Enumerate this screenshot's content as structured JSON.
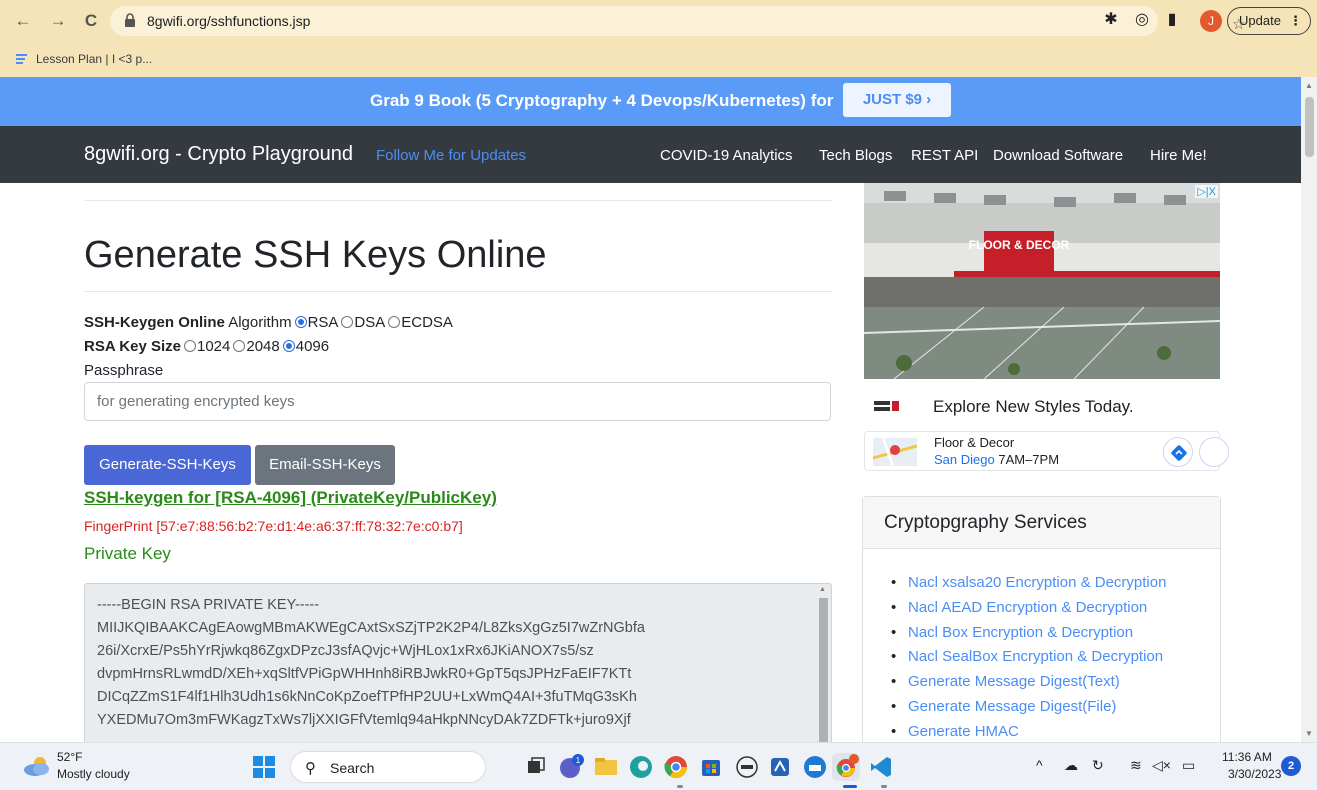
{
  "browser": {
    "url": "8gwifi.org/sshfunctions.jsp",
    "update_label": "Update",
    "profile_initial": "J",
    "bookmark": "Lesson Plan | I <3 p..."
  },
  "promo": {
    "text": "Grab 9 Book (5 Cryptography + 4 Devops/Kubernetes) for",
    "button": "JUST $9 ›"
  },
  "navbar": {
    "brand": "8gwifi.org - Crypto Playground",
    "follow": "Follow Me for Updates",
    "links": [
      "COVID-19 Analytics",
      "Tech Blogs",
      "REST API",
      "Download Software",
      "Hire Me!"
    ]
  },
  "main": {
    "title": "Generate SSH Keys Online",
    "algo_label": "SSH-Keygen Online",
    "algo_word": "Algorithm",
    "algorithms": [
      "RSA",
      "DSA",
      "ECDSA"
    ],
    "selected_algorithm": "RSA",
    "keysize_label": "RSA Key Size",
    "key_sizes": [
      "1024",
      "2048",
      "4096"
    ],
    "selected_key_size": "4096",
    "passphrase_label": "Passphrase",
    "passphrase_placeholder": "for generating encrypted keys",
    "generate_button": "Generate-SSH-Keys",
    "email_button": "Email-SSH-Keys",
    "result_link": "SSH-keygen for [RSA-4096] (PrivateKey/PublicKey)",
    "fingerprint": "FingerPrint [57:e7:88:56:b2:7e:d1:4e:a6:37:ff:78:32:7e:c0:b7]",
    "private_key_label": "Private Key",
    "private_key_lines": [
      "-----BEGIN RSA PRIVATE KEY-----",
      "MIIJKQIBAAKCAgEAowgMBmAKWEgCAxtSxSZjTP2K2P4/L8ZksXgGz5I7wZrNGbfa",
      "26i/XcrxE/Ps5hYrRjwkq86ZgxDPzcJ3sfAQvjc+WjHLox1xRx6JKiANOX7s5/sz",
      "dvpmHrnsRLwmdD/XEh+xqSltfVPiGpWHHnh8iRBJwkR0+GpT5qsJPHzFaEIF7KTt",
      "DICqZZmS1F4lf1Hlh3Udh1s6kNnCoKpZoefTPfHP2UU+LxWmQ4AI+3fuTMqG3sKh",
      "YXEDMu7Om3mFWKagzTxWs7ljXXIGFfVtemlq94aHkpNNcyDAk7ZDFTk+juro9Xjf"
    ]
  },
  "ad": {
    "choices": "▷|X",
    "sign_text": "FLOOR & DECOR",
    "headline": "Explore New Styles Today.",
    "store": "Floor & Decor",
    "location": "San Diego",
    "hours": "7AM–7PM"
  },
  "services": {
    "title": "Cryptopgraphy Services",
    "items": [
      "Nacl xsalsa20 Encryption & Decryption",
      "Nacl AEAD Encryption & Decryption",
      "Nacl Box Encryption & Decryption",
      "Nacl SealBox Encryption & Decryption",
      "Generate Message Digest(Text)",
      "Generate Message Digest(File)",
      "Generate HMAC"
    ]
  },
  "taskbar": {
    "temperature": "52°F",
    "weather": "Mostly cloudy",
    "search": "Search",
    "time": "11:36 AM",
    "date": "3/30/2023",
    "notifications": "2",
    "chat_badge": "1"
  },
  "colors": {
    "promo_bg": "#5b9bf8",
    "navbar_bg": "#343a40",
    "link_blue": "#4a8ef5",
    "success_green": "#2a8a19",
    "danger_red": "#d72424",
    "primary_button": "#4a67d6",
    "chrome_bg": "#f6e4b9"
  }
}
